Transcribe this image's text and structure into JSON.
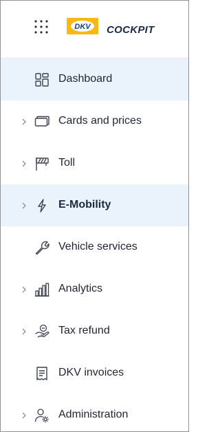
{
  "brand": {
    "logo_text": "DKV",
    "app_name": "COCKPIT",
    "logo_color": "#fbb813",
    "logo_text_color": "#1b3a8a"
  },
  "colors": {
    "active_background": "#eaf2fb",
    "text": "#1f2430",
    "icon": "#3b4150",
    "chevron": "#8a8f98"
  },
  "menu": [
    {
      "label": "Dashboard",
      "icon": "dashboard-grid-icon",
      "has_chevron": false,
      "active": true,
      "bold": false
    },
    {
      "label": "Cards and prices",
      "icon": "cards-icon",
      "has_chevron": true,
      "active": false,
      "bold": false
    },
    {
      "label": "Toll",
      "icon": "toll-sign-icon",
      "has_chevron": true,
      "active": false,
      "bold": false
    },
    {
      "label": "E-Mobility",
      "icon": "lightning-icon",
      "has_chevron": true,
      "active": true,
      "bold": true
    },
    {
      "label": "Vehicle services",
      "icon": "wrench-icon",
      "has_chevron": false,
      "active": false,
      "bold": false
    },
    {
      "label": "Analytics",
      "icon": "bar-chart-icon",
      "has_chevron": true,
      "active": false,
      "bold": false
    },
    {
      "label": "Tax refund",
      "icon": "hand-coin-icon",
      "has_chevron": true,
      "active": false,
      "bold": false
    },
    {
      "label": "DKV invoices",
      "icon": "invoice-icon",
      "has_chevron": false,
      "active": false,
      "bold": false
    },
    {
      "label": "Administration",
      "icon": "user-gear-icon",
      "has_chevron": true,
      "active": false,
      "bold": false
    }
  ]
}
